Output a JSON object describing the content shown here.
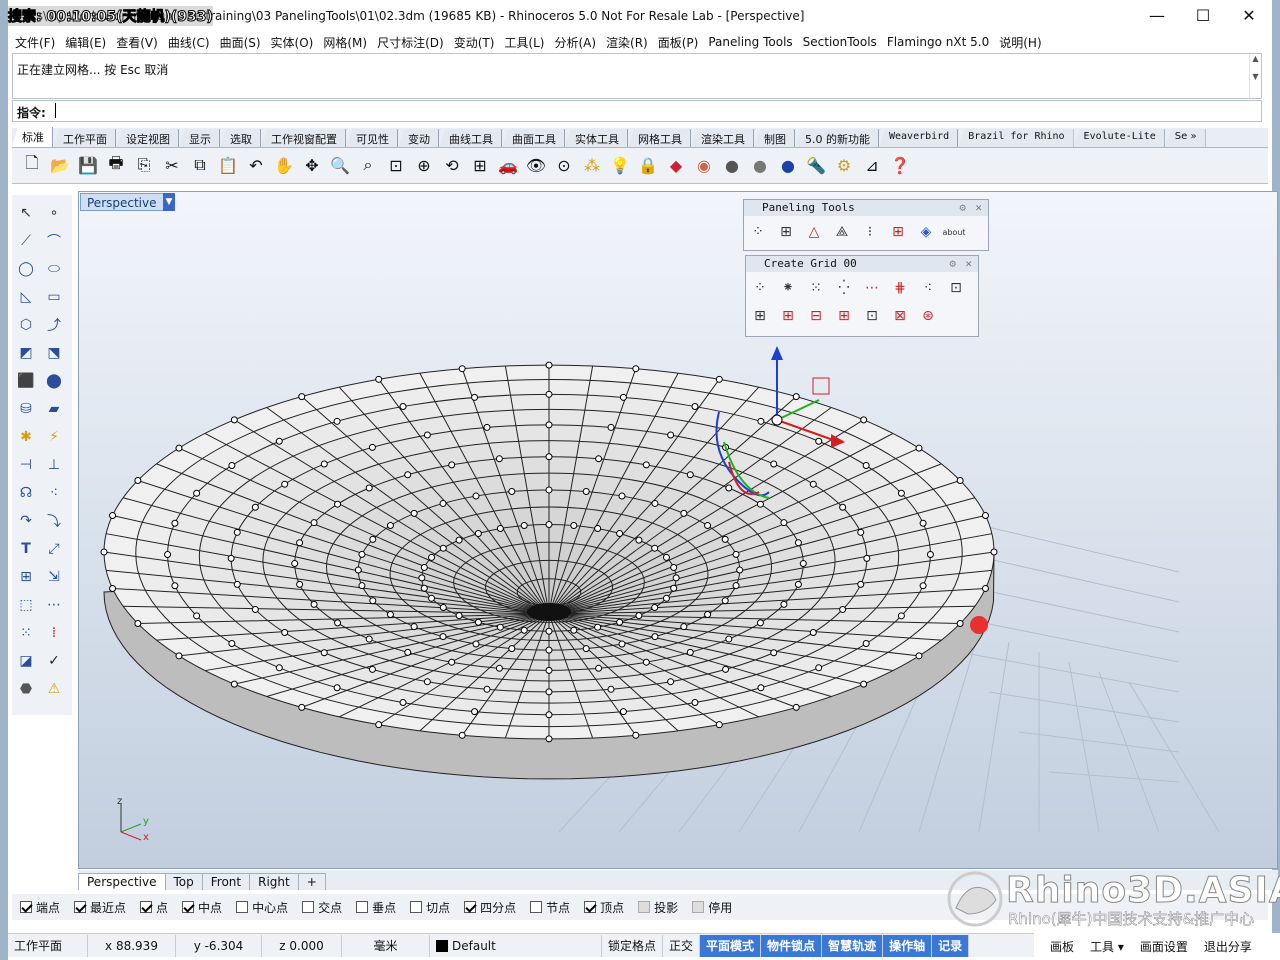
{
  "overlay": {
    "text": "搜索: 00:10:05(天龍帆)(933)"
  },
  "window": {
    "title": "ts\\My Work\\Working\\On Line training\\03 PanelingTools\\01\\02.3dm (19685 KB) - Rhinoceros 5.0 Not For Resale Lab - [Perspective]",
    "minimize": "—",
    "maximize": "☐",
    "close": "✕"
  },
  "menu": [
    "文件(F)",
    "编辑(E)",
    "查看(V)",
    "曲线(C)",
    "曲面(S)",
    "实体(O)",
    "网格(M)",
    "尺寸标注(D)",
    "变动(T)",
    "工具(L)",
    "分析(A)",
    "渲染(R)",
    "面板(P)",
    "Paneling Tools",
    "SectionTools",
    "Flamingo nXt 5.0",
    "说明(H)"
  ],
  "command": {
    "history": "正在建立网格... 按 Esc 取消",
    "prompt_label": "指令:",
    "value": ""
  },
  "tabs": [
    "标准",
    "工作平面",
    "设定视图",
    "显示",
    "选取",
    "工作视窗配置",
    "可见性",
    "变动",
    "曲线工具",
    "曲面工具",
    "实体工具",
    "网格工具",
    "渲染工具",
    "制图",
    "5.0 的新功能",
    "Weaverbird",
    "Brazil for Rhino",
    "Evolute-Lite",
    "Se »"
  ],
  "viewport": {
    "title": "Perspective",
    "axis": {
      "z": "z",
      "y": "y",
      "x": "x"
    }
  },
  "panels": {
    "paneling": {
      "title": "Paneling Tools",
      "about": "about"
    },
    "grid": {
      "title": "Create Grid 00"
    }
  },
  "view_tabs": [
    "Perspective",
    "Top",
    "Front",
    "Right",
    "+"
  ],
  "osnap": [
    {
      "label": "端点",
      "checked": true
    },
    {
      "label": "最近点",
      "checked": true
    },
    {
      "label": "点",
      "checked": true
    },
    {
      "label": "中点",
      "checked": true
    },
    {
      "label": "中心点",
      "checked": false
    },
    {
      "label": "交点",
      "checked": false
    },
    {
      "label": "垂点",
      "checked": false
    },
    {
      "label": "切点",
      "checked": false
    },
    {
      "label": "四分点",
      "checked": true
    },
    {
      "label": "节点",
      "checked": false
    },
    {
      "label": "顶点",
      "checked": true
    },
    {
      "label": "投影",
      "checked": false,
      "disabled": true
    },
    {
      "label": "停用",
      "checked": false,
      "disabled": true
    }
  ],
  "status": {
    "cplane": "工作平面",
    "x": "x 88.939",
    "y": "y -6.304",
    "z": "z 0.000",
    "unit": "毫米",
    "layer": "Default",
    "toggles": [
      "锁定格点",
      "正交",
      "平面模式",
      "物件锁点",
      "智慧轨迹",
      "操作轴",
      "记录"
    ]
  },
  "brand": {
    "big": "Rhino3D.ASIA",
    "small": "Rhino(犀牛)中国技术支持&推广中心"
  },
  "player": [
    "画板",
    "工具 ▾",
    "画面设置",
    "退出分享"
  ],
  "colors": {
    "accent": "#3a78d8",
    "viewport_bg": "#e3e9f1",
    "mesh_face": "#e6e6e6"
  }
}
